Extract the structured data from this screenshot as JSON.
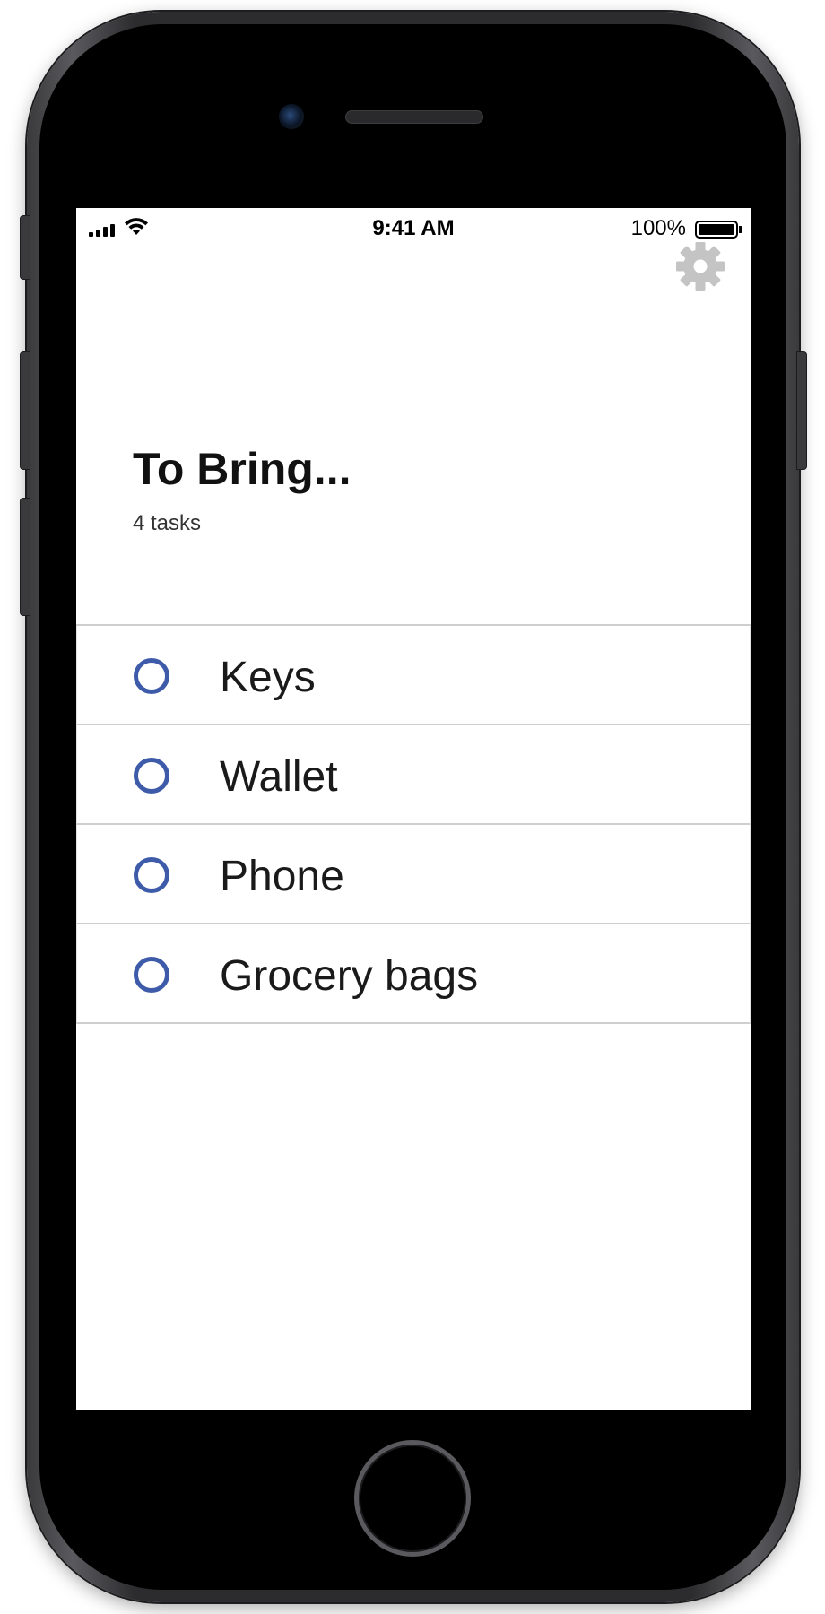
{
  "status_bar": {
    "time": "9:41 AM",
    "battery_percent": "100%",
    "battery_level": 1.0,
    "signal_bars": 4,
    "wifi_icon": "wifi-icon"
  },
  "header": {
    "settings_icon": "gear-icon",
    "title": "To Bring...",
    "task_count": "4 tasks"
  },
  "tasks": [
    {
      "label": "Keys",
      "checked": false
    },
    {
      "label": "Wallet",
      "checked": false
    },
    {
      "label": "Phone",
      "checked": false
    },
    {
      "label": "Grocery bags",
      "checked": false
    }
  ],
  "colors": {
    "accent": "#3d5ba9",
    "gear": "#c4c4c4",
    "divider": "#cfcfcf"
  }
}
